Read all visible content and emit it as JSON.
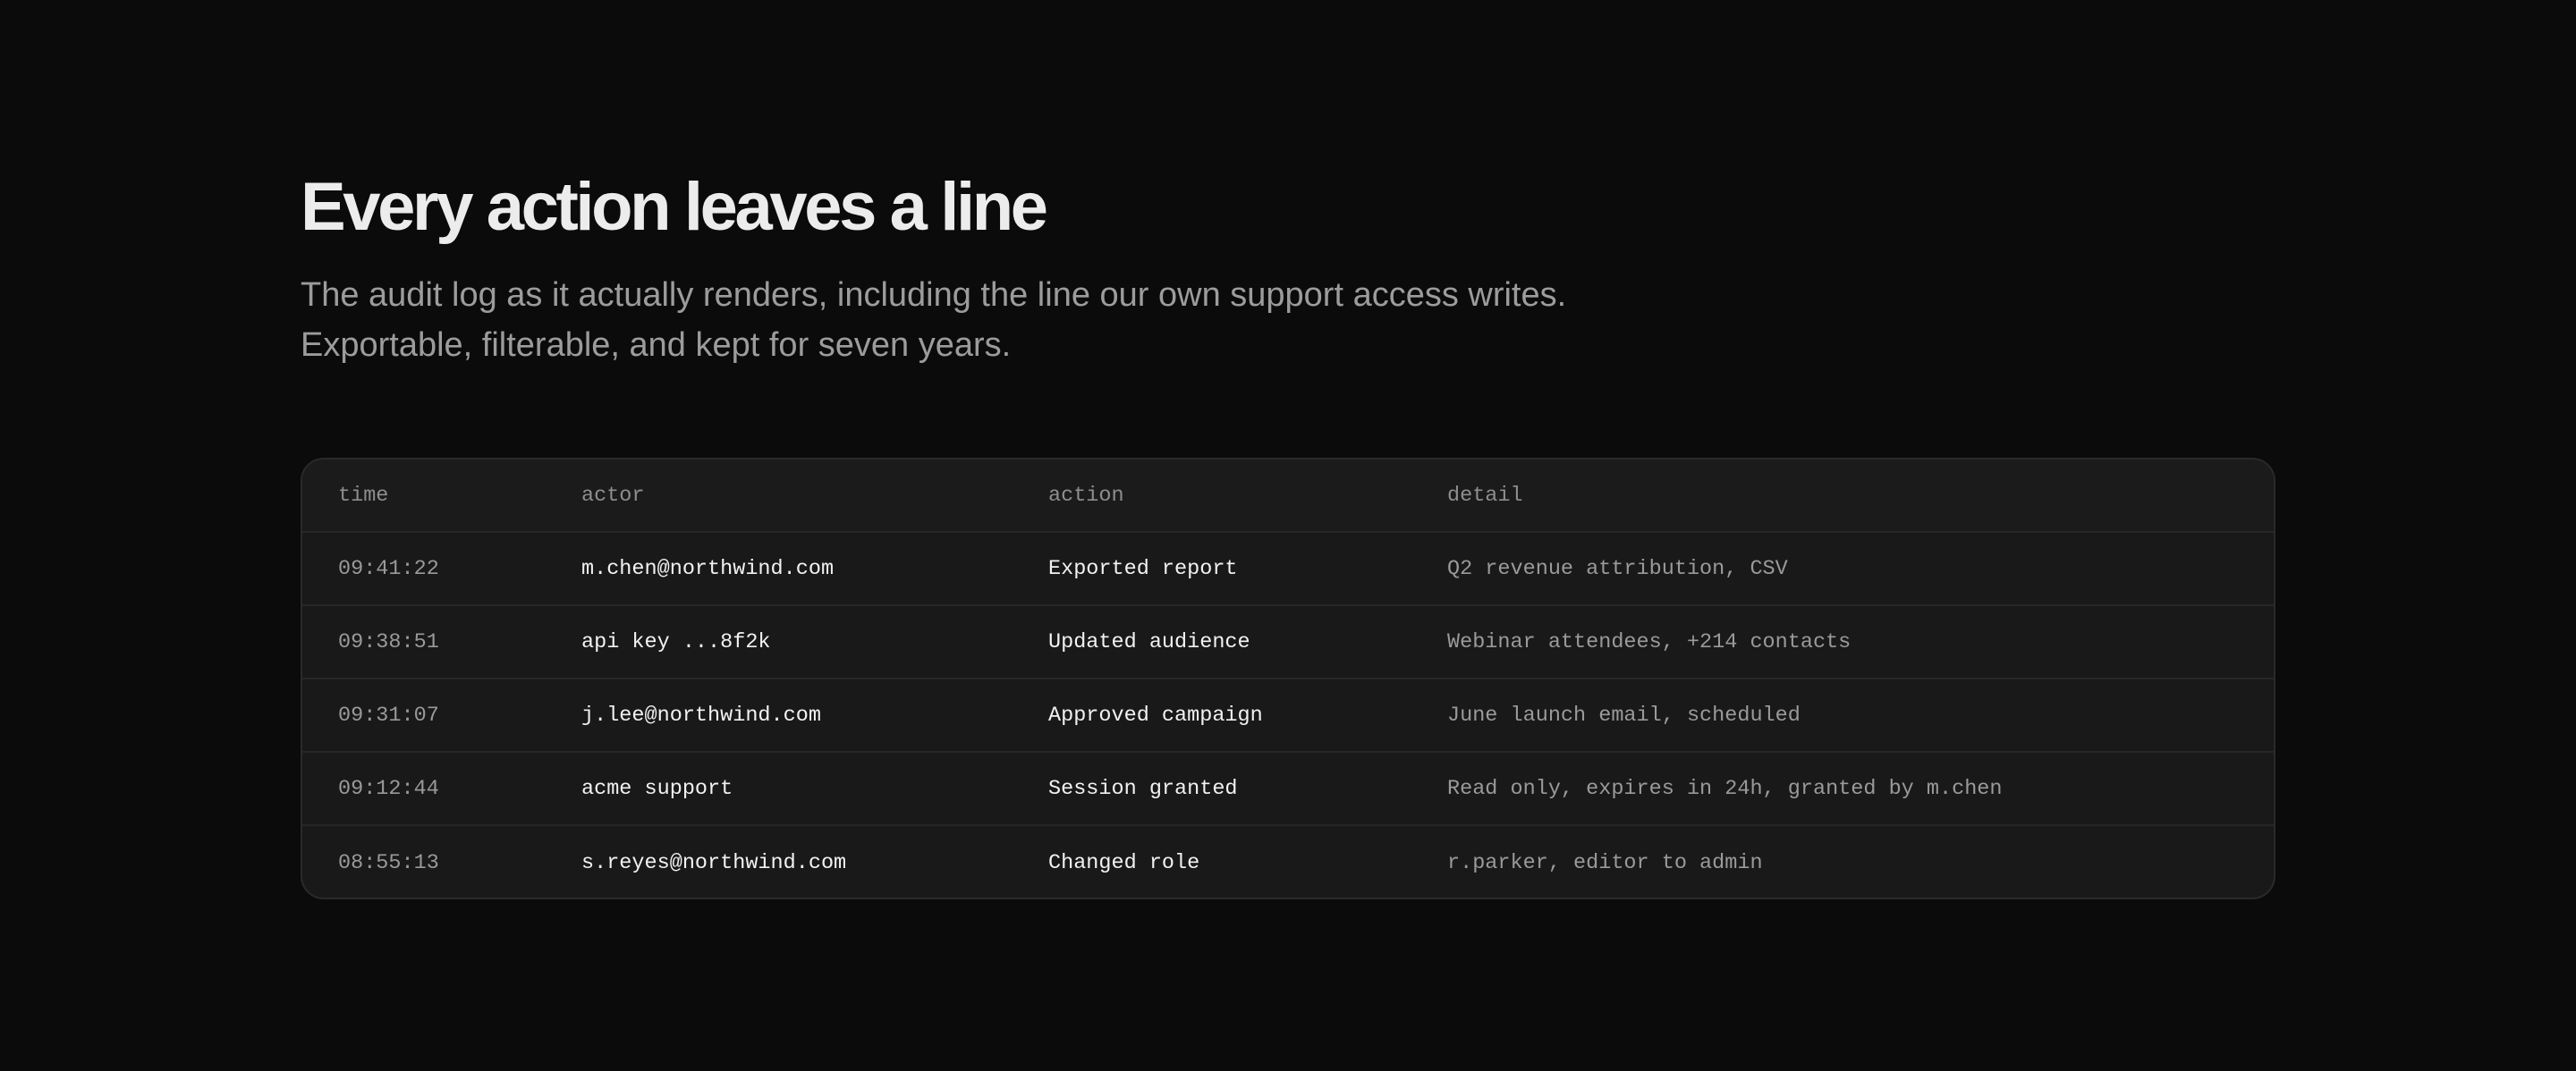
{
  "header": {
    "title": "Every action leaves a line",
    "subtitle": "The audit log as it actually renders, including the line our own support access writes. Exportable, filterable, and kept for seven years."
  },
  "audit_table": {
    "columns": {
      "time": "time",
      "actor": "actor",
      "action": "action",
      "detail": "detail"
    },
    "rows": [
      {
        "time": "09:41:22",
        "actor": "m.chen@northwind.com",
        "action": "Exported report",
        "detail": "Q2 revenue attribution, CSV"
      },
      {
        "time": "09:38:51",
        "actor": "api key ...8f2k",
        "action": "Updated audience",
        "detail": "Webinar attendees, +214 contacts"
      },
      {
        "time": "09:31:07",
        "actor": "j.lee@northwind.com",
        "action": "Approved campaign",
        "detail": "June launch email, scheduled"
      },
      {
        "time": "09:12:44",
        "actor": "acme support",
        "action": "Session granted",
        "detail": "Read only, expires in 24h, granted by m.chen"
      },
      {
        "time": "08:55:13",
        "actor": "s.reyes@northwind.com",
        "action": "Changed role",
        "detail": "r.parker, editor to admin"
      }
    ]
  },
  "colors": {
    "background": "#0b0b0b",
    "card": "#191919",
    "border": "#2a2a2a",
    "title": "#ececec",
    "muted": "#9c9c9c"
  }
}
